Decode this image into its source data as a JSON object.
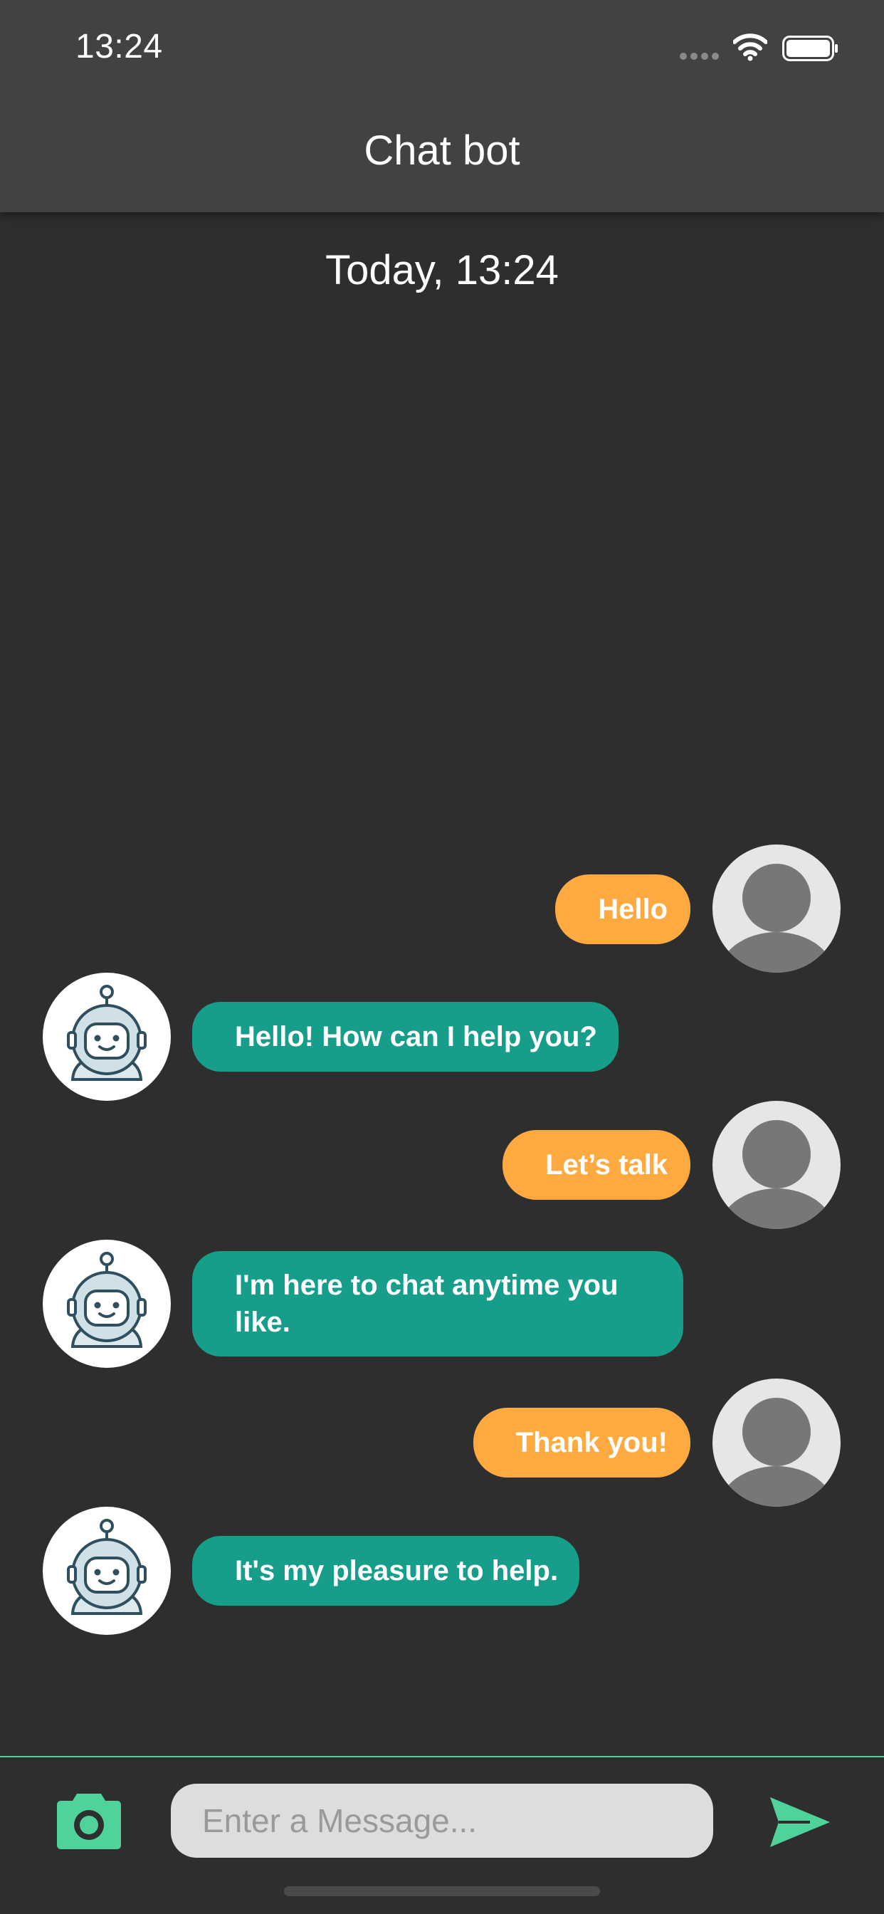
{
  "status_bar": {
    "time": "13:24"
  },
  "header": {
    "title": "Chat bot"
  },
  "chat": {
    "date_label": "Today, 13:24",
    "messages": [
      {
        "sender": "user",
        "text": "Hello"
      },
      {
        "sender": "bot",
        "text": "Hello! How can I help you?"
      },
      {
        "sender": "user",
        "text": "Let’s talk"
      },
      {
        "sender": "bot",
        "text": "I'm here to chat anytime you like."
      },
      {
        "sender": "user",
        "text": "Thank you!"
      },
      {
        "sender": "bot",
        "text": "It's my pleasure to help."
      }
    ]
  },
  "composer": {
    "placeholder": "Enter a Message...",
    "camera_icon": "camera-icon",
    "send_icon": "send-icon"
  },
  "colors": {
    "header_bg": "#424242",
    "background": "#2e2e2e",
    "user_bubble": "#ffaa40",
    "bot_bubble": "#169e8a",
    "accent": "#4fd39a"
  }
}
